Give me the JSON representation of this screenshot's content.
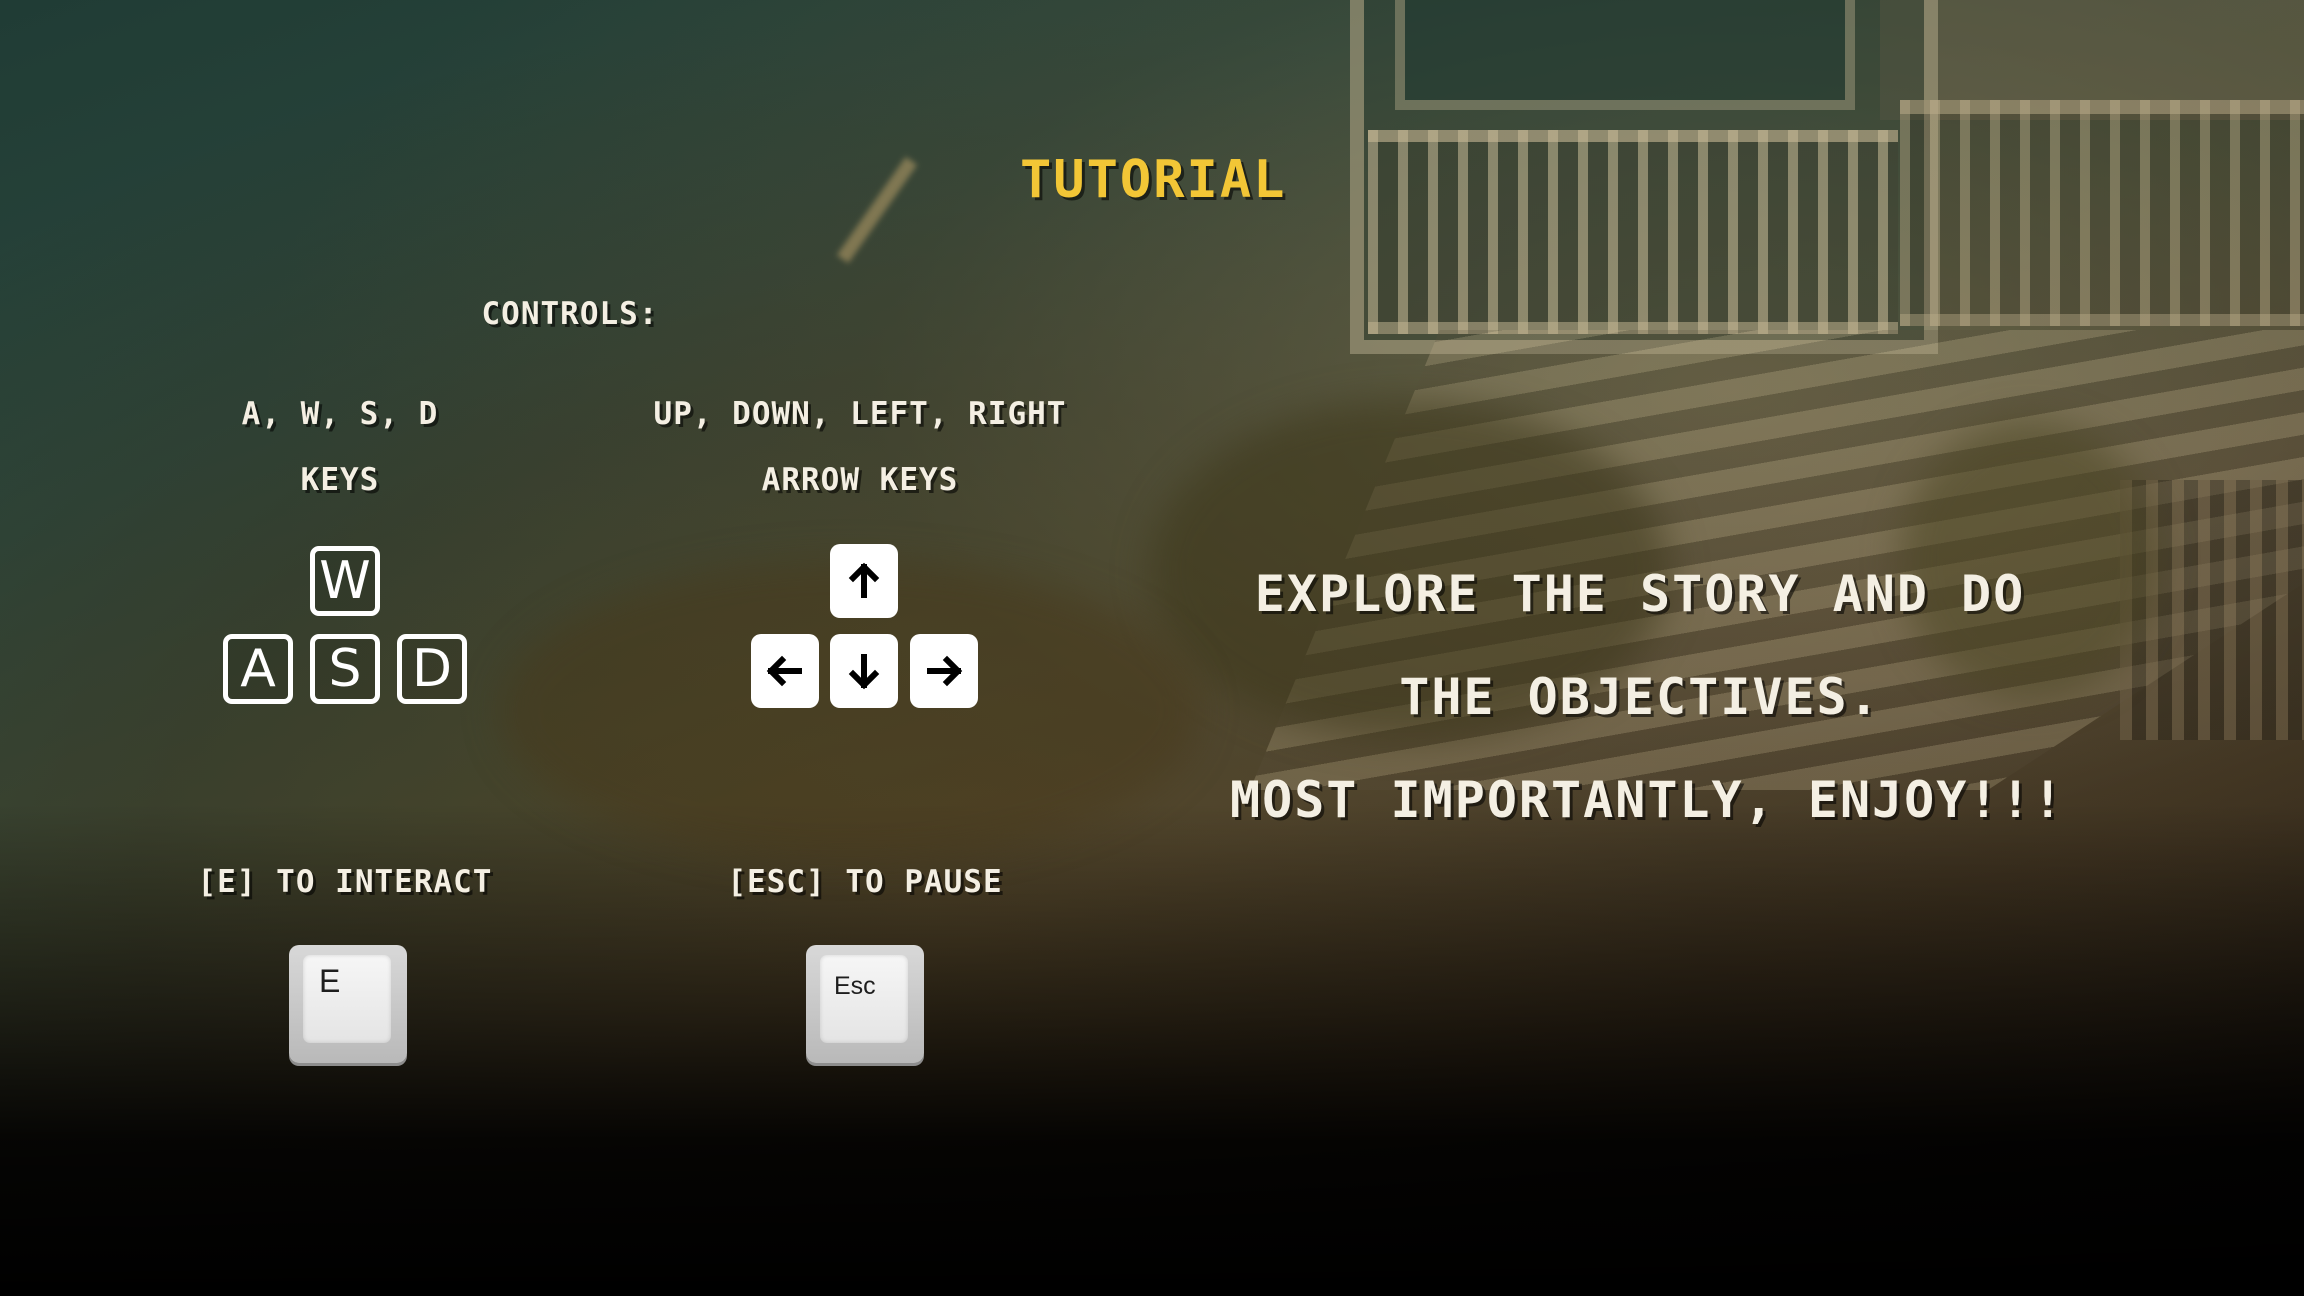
{
  "title": "TUTORIAL",
  "controls_label": "CONTROLS:",
  "wasd": {
    "line1": "A, W, S, D",
    "line2": "KEYS",
    "keys": {
      "w": "W",
      "a": "A",
      "s": "S",
      "d": "D"
    }
  },
  "arrows": {
    "line1": "UP, DOWN, LEFT, RIGHT",
    "line2": "ARROW KEYS",
    "icons": [
      "arrow-up-icon",
      "arrow-left-icon",
      "arrow-down-icon",
      "arrow-right-icon"
    ]
  },
  "interact": {
    "label": "[E] TO INTERACT",
    "key": "E"
  },
  "pause": {
    "label": "[ESC] TO PAUSE",
    "key": "Esc"
  },
  "message": {
    "line1": "EXPLORE THE STORY AND DO",
    "line2": "THE OBJECTIVES.",
    "line3": "MOST IMPORTANTLY, ENJOY!!!"
  },
  "colors": {
    "title": "#f2c636",
    "text": "#f4efe3"
  }
}
